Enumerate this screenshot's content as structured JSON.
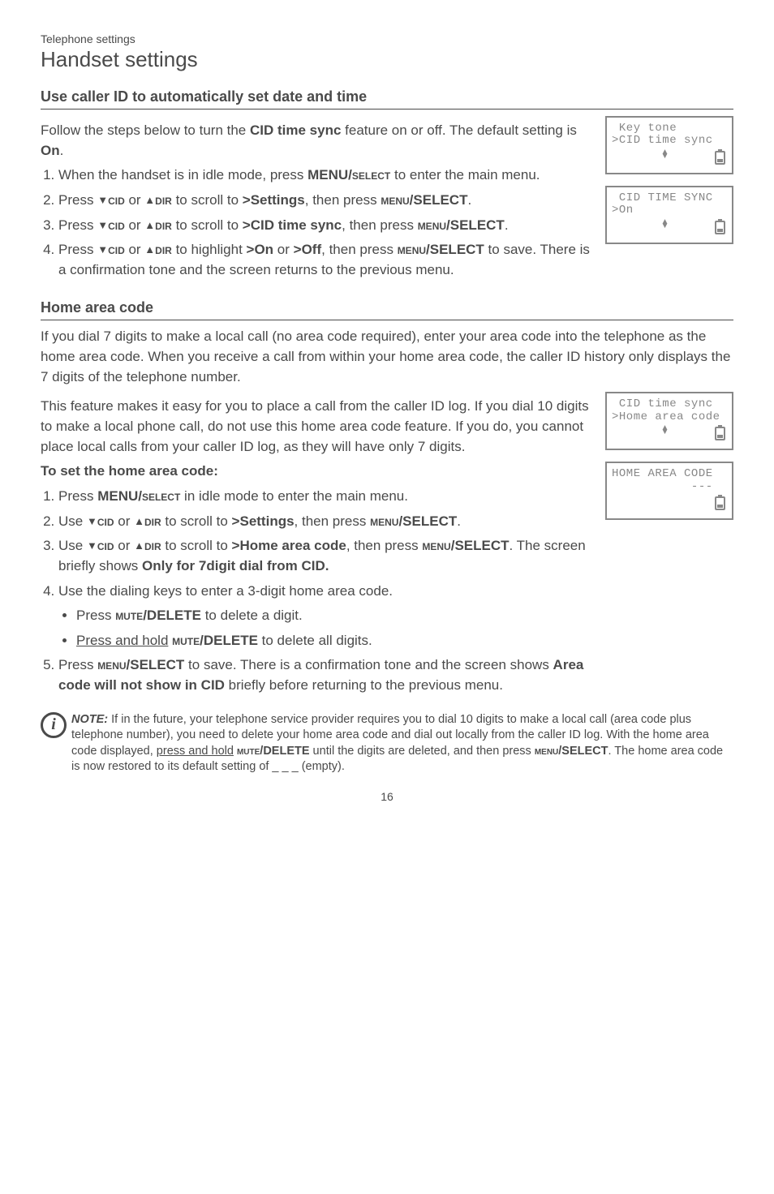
{
  "breadcrumb": "Telephone settings",
  "pageTitle": "Handset settings",
  "section1": {
    "title": "Use caller ID to automatically set date and time",
    "intro_a": "Follow the steps below to turn the ",
    "intro_b": "CID time sync",
    "intro_c": " feature on or off. The default setting is ",
    "intro_d": "On",
    "intro_e": ".",
    "step1_a": "When the handset is in idle mode, press ",
    "step1_b": "MENU/",
    "step1_c": "select",
    "step1_d": " to enter the main menu.",
    "step2_a": "Press ",
    "step2_b": "cid",
    "step2_c": " or ",
    "step2_d": "dir",
    "step2_e": " to scroll to ",
    "step2_f": ">Settings",
    "step2_g": ", then press ",
    "step2_h": "menu",
    "step2_i": "/SELECT",
    "step2_j": ".",
    "step3_a": "Press ",
    "step3_f": ">CID time sync",
    "step3_g": ", then press ",
    "step4_a": "Press ",
    "step4_e": " to highlight ",
    "step4_f": ">On",
    "step4_g": " or ",
    "step4_h": ">Off",
    "step4_i": ", then press ",
    "step4_j": "menu",
    "step4_k": "/SELECT",
    "step4_l": " to save. There is a confirmation tone and the screen returns to the previous menu."
  },
  "screens": {
    "s1_l1": " Key tone",
    "s1_l2": ">CID time sync",
    "s2_l1": " CID TIME SYNC",
    "s2_l2": ">On",
    "s3_l1": " CID time sync",
    "s3_l2": ">Home area code",
    "s4_l1": "HOME AREA CODE",
    "s4_l2": "           ---"
  },
  "section2": {
    "title": "Home area code",
    "p1": "If you dial 7 digits to make a local call (no area code required), enter your area code into the telephone as the home area code. When you receive a call from within your home area code, the caller ID history only displays the 7 digits of the telephone number.",
    "p2": "This feature makes it easy for you to place a call from the caller ID log. If you dial 10 digits to make a local phone call, do not use this home area code feature. If you do, you cannot place local calls from your caller ID log, as they will have only 7 digits.",
    "sub": "To set the home area code:",
    "step1_a": "Press ",
    "step1_b": "MENU/",
    "step1_c": "select",
    "step1_d": " in idle mode to enter the main menu.",
    "step2_a": "Use ",
    "step3_f": ">Home area code",
    "step3_g": ", then press ",
    "step3_j": ". The screen briefly shows ",
    "step3_k": "Only for 7digit dial from CID.",
    "step4": "Use the dialing keys to enter a 3-digit home area code.",
    "b1_a": "Press ",
    "b1_b": "mute",
    "b1_c": "/DELETE",
    "b1_d": " to delete a digit.",
    "b2_a": "Press and hold",
    "b2_b": " ",
    "b2_d": " to delete all digits.",
    "step5_a": "Press ",
    "step5_b": "menu",
    "step5_c": "/SELECT",
    "step5_d": " to save. There is a confirmation tone and the screen shows ",
    "step5_e": "Area code will not show in CID",
    "step5_f": " briefly before returning to the previous menu."
  },
  "note": {
    "label": "NOTE:",
    "a": " If in the future, your telephone service provider requires you to dial 10 digits to make a local call (area code plus telephone number), you need to delete your home area code and dial out locally from the caller ID log. With the home area code displayed, ",
    "b": "press and hold",
    "c": " ",
    "d": "mute",
    "e": "/DELETE",
    "f": " until the digits are deleted, and then press ",
    "g": "menu",
    "h": "/SELECT",
    "i": ". The home area code is now restored to its default setting of _ _ _ (empty)."
  },
  "pageNum": "16"
}
